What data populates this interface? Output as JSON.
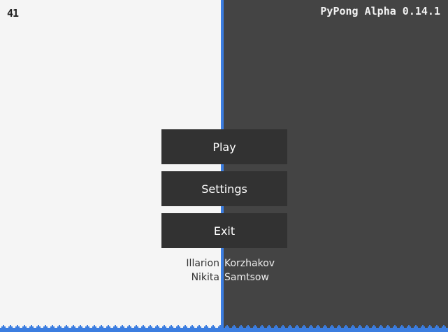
{
  "hud": {
    "fps": "41",
    "title": "PyPong Alpha 0.14.1"
  },
  "menu": {
    "buttons": [
      {
        "label": "Play"
      },
      {
        "label": "Settings"
      },
      {
        "label": "Exit"
      }
    ]
  },
  "credits": [
    {
      "first": "Illarion",
      "last": "Korzhakov"
    },
    {
      "first": "Nikita",
      "last": "Samtsow"
    }
  ],
  "colors": {
    "left_field": "#f5f5f5",
    "right_field": "#444444",
    "divider": "#3b7de0",
    "button": "#323232",
    "floor": "#3b7de0"
  }
}
